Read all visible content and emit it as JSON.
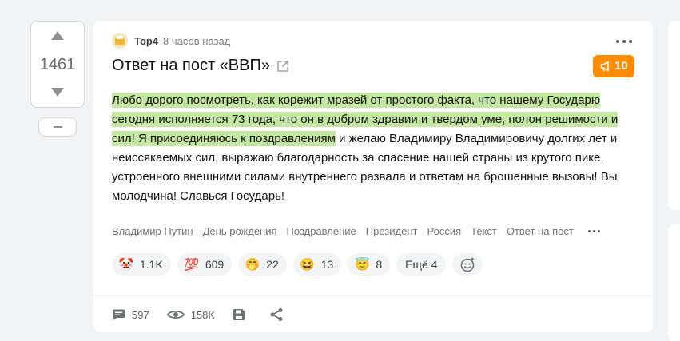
{
  "vote": {
    "count": "1461"
  },
  "post": {
    "author": "Top4",
    "time": "8 часов назад",
    "title": "Ответ на пост «ВВП»",
    "rating": "10",
    "text_highlight": "Любо дорого посмотреть, как корежит мразей от простого факта, что нашему Государю сегодня исполняется 73 года, что он в добром здравии и твердом уме, полон решимости и сил! Я присоединяюсь к поздравлениям",
    "text_rest": " и желаю Владимиру Владимировичу долгих лет и неиссякаемых сил, выражаю благодарность за спасение нашей страны из крутого пике, устроенного внешними силами внутреннего развала и ответам на брошенные вызовы! Вы молодчина! Славься Государь!",
    "tags": [
      "Владимир Путин",
      "День рождения",
      "Поздравление",
      "Президент",
      "Россия",
      "Текст",
      "Ответ на пост"
    ]
  },
  "reactions": [
    {
      "icon": "clown-face-icon",
      "emoji": "🤡",
      "count": "1.1K"
    },
    {
      "icon": "hundred-points-icon",
      "emoji": "💯",
      "count": "609"
    },
    {
      "icon": "face-with-hand-over-mouth-icon",
      "emoji": "🤭",
      "count": "22"
    },
    {
      "icon": "grinning-squinting-face-icon",
      "emoji": "😆",
      "count": "13"
    },
    {
      "icon": "smiling-face-with-halo-icon",
      "emoji": "😇",
      "count": "8"
    }
  ],
  "reactions_more": "Ещё 4",
  "footer": {
    "comments": "597",
    "views": "158K"
  },
  "colors": {
    "accent": "#ff8c00",
    "highlight": "#c3e6a0",
    "background": "#f2f3f5"
  }
}
